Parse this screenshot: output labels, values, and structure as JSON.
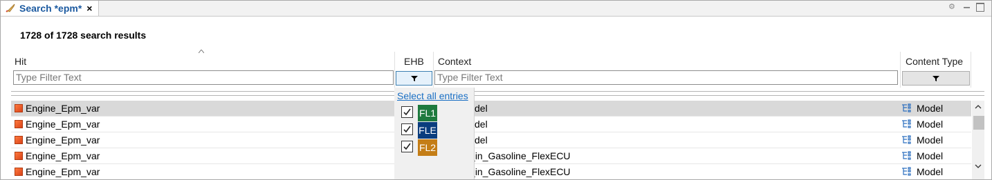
{
  "tab": {
    "title": "Search *epm*",
    "close": "×"
  },
  "summary": "1728 of 1728 search results",
  "columns": {
    "hit": "Hit",
    "ehb": "EHB",
    "context": "Context",
    "content_type": "Content Type"
  },
  "filters": {
    "hit_placeholder": "Type Filter Text",
    "context_placeholder": "Type Filter Text"
  },
  "popup": {
    "select_all": "Select all entries",
    "entries": [
      {
        "label": "FL1",
        "color": "#1e7a3e",
        "checked": true
      },
      {
        "label": "FLE",
        "color": "#0a3d7e",
        "checked": true
      },
      {
        "label": "FL2",
        "color": "#c47d16",
        "checked": true
      }
    ]
  },
  "rows": [
    {
      "hit": "Engine_Epm_var",
      "context": "activeModel",
      "type": "Model",
      "selected": true
    },
    {
      "hit": "Engine_Epm_var",
      "context": "activeModel",
      "type": "Model",
      "selected": false
    },
    {
      "hit": "Engine_Epm_var",
      "context": "activeModel",
      "type": "Model",
      "selected": false
    },
    {
      "hit": "Engine_Epm_var",
      "context": "libration_in_Gasoline_FlexECU",
      "type": "Model",
      "selected": false
    },
    {
      "hit": "Engine_Epm_var",
      "context": "libration_in_Gasoline_FlexECU",
      "type": "Model",
      "selected": false
    }
  ],
  "colors": {
    "accent": "#1c5aa0",
    "selection": "#d9d9d9",
    "hit_icon": "#e8531d"
  }
}
